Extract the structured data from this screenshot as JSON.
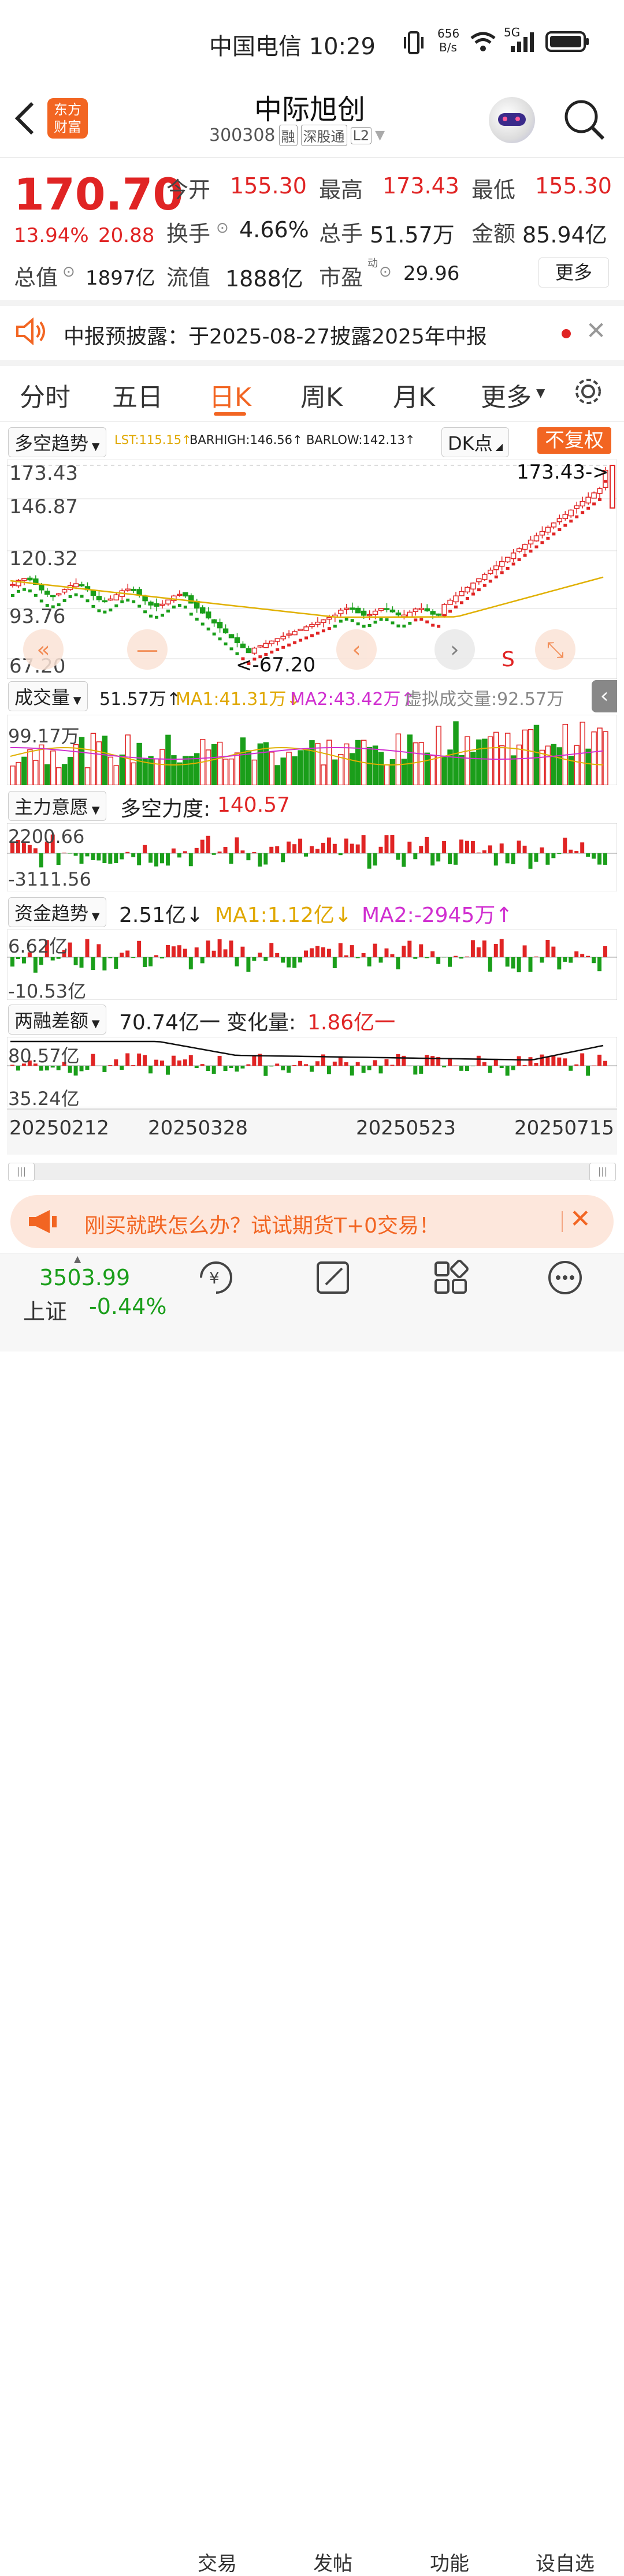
{
  "status": {
    "carrier": "中国电信 10:29",
    "net_speed_top": "656",
    "net_speed_bottom": "B/s",
    "network": "5G"
  },
  "header": {
    "logo_line1": "东方",
    "logo_line2": "财富",
    "stock_name": "中际旭创",
    "code": "300308",
    "badge_rong": "融",
    "badge_sgt": "深股通",
    "badge_l2": "L2"
  },
  "quote": {
    "price": "170.70",
    "change_pct": "13.94%",
    "change": "20.88",
    "open_label": "今开",
    "open": "155.30",
    "high_label": "最高",
    "high": "173.43",
    "low_label": "最低",
    "low": "155.30",
    "turnover_label": "换手",
    "turnover": "4.66%",
    "volume_label": "总手",
    "volume": "51.57万",
    "amount_label": "金额",
    "amount": "85.94亿",
    "mcap_label": "总值",
    "mcap": "1897亿",
    "float_label": "流值",
    "float": "1888亿",
    "pe_label": "市盈",
    "pe_sup": "动",
    "pe": "29.96",
    "more": "更多"
  },
  "notice": {
    "text": "中报预披露：于2025-08-27披露2025年中报"
  },
  "period_tabs": [
    "分时",
    "五日",
    "日K",
    "周K",
    "月K",
    "更多"
  ],
  "active_tab": "日K",
  "kline": {
    "indicator": "多空趋势",
    "lst": "LST:115.15↑",
    "barhigh": "BARHIGH:146.56↑",
    "barlow": "BARLOW:142.13↑",
    "dk": "DK点",
    "fq": "不复权",
    "y_labels": [
      "173.43",
      "146.87",
      "120.32",
      "93.76",
      "67.20"
    ],
    "max_callout": "173.43->",
    "min_callout": "<-67.20",
    "s_marker": "S"
  },
  "volume": {
    "label": "成交量",
    "value": "51.57万↑",
    "ma1": "MA1:41.31万↓",
    "ma2": "MA2:43.42万↑",
    "virtual": "虚拟成交量:92.57万",
    "ymax": "99.17万"
  },
  "zhuli": {
    "label": "主力意愿",
    "title": "多空力度:",
    "value": "140.57",
    "ymax": "2200.66",
    "ymin": "-3111.56"
  },
  "zijin": {
    "label": "资金趋势",
    "value": "2.51亿↓",
    "ma1": "MA1:1.12亿↓",
    "ma2": "MA2:-2945万↑",
    "ymax": "6.62亿",
    "ymin": "-10.53亿"
  },
  "liangrong": {
    "label": "两融差额",
    "value": "70.74亿一",
    "change_label": "变化量:",
    "change": "1.86亿一",
    "ymax": "80.57亿",
    "ymin": "35.24亿"
  },
  "x_dates": [
    "20250212",
    "20250328",
    "20250523",
    "20250715"
  ],
  "ad": {
    "text": "刚买就跌怎么办？试试期货T+0交易！"
  },
  "bottom": {
    "index_value": "3503.99",
    "index_name": "上证",
    "index_change": "-0.44%",
    "nav": [
      "交易",
      "发帖",
      "功能",
      "设自选"
    ]
  },
  "colors": {
    "up": "#e02424",
    "down": "#1a9e1a",
    "accent": "#f26522",
    "ma_gold": "#e0b000",
    "ma_mag": "#d02fd0"
  },
  "chart_data": {
    "type": "candlestick",
    "x_range": [
      "20250212",
      "20250715"
    ],
    "ylim": [
      67.2,
      173.43
    ],
    "last_close": 170.7,
    "period_high": 173.43,
    "period_low": 67.2
  }
}
